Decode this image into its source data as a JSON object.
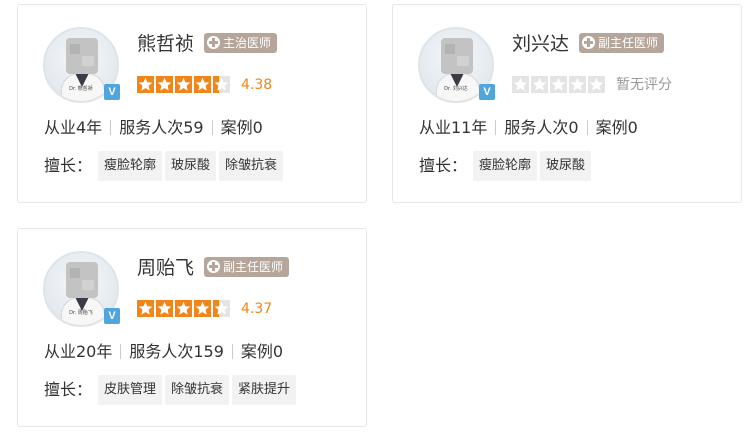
{
  "doctors": [
    {
      "name": "熊哲祯",
      "title": "主治医师",
      "avatar_caption": "Dr. 熊哲祯",
      "rating": 4.38,
      "score_text": "4.38",
      "years": "从业4年",
      "services": "服务人次59",
      "cases": "案例0",
      "specialty_label": "擅长：",
      "specialties": [
        "瘦脸轮廓",
        "玻尿酸",
        "除皱抗衰"
      ]
    },
    {
      "name": "刘兴达",
      "title": "副主任医师",
      "avatar_caption": "Dr. 刘兴达",
      "rating": 0,
      "score_text": "暂无评分",
      "years": "从业11年",
      "services": "服务人次0",
      "cases": "案例0",
      "specialty_label": "擅长：",
      "specialties": [
        "瘦脸轮廓",
        "玻尿酸"
      ]
    },
    {
      "name": "周贻飞",
      "title": "副主任医师",
      "avatar_caption": "Dr. 周贻飞",
      "rating": 4.37,
      "score_text": "4.37",
      "years": "从业20年",
      "services": "服务人次159",
      "cases": "案例0",
      "specialty_label": "擅长：",
      "specialties": [
        "皮肤管理",
        "除皱抗衰",
        "紧肤提升"
      ]
    }
  ],
  "verified_mark": "V",
  "icons": {
    "title": "plus-circle-icon",
    "star": "star-icon",
    "verified": "verified-v-icon"
  },
  "colors": {
    "star_filled": "#f08519",
    "star_empty": "#e4e4e4",
    "title_badge": "#b5a59a",
    "verified": "#4ea6dc",
    "tag_bg": "#f2f2f2",
    "card_border": "#e7e7e7"
  }
}
